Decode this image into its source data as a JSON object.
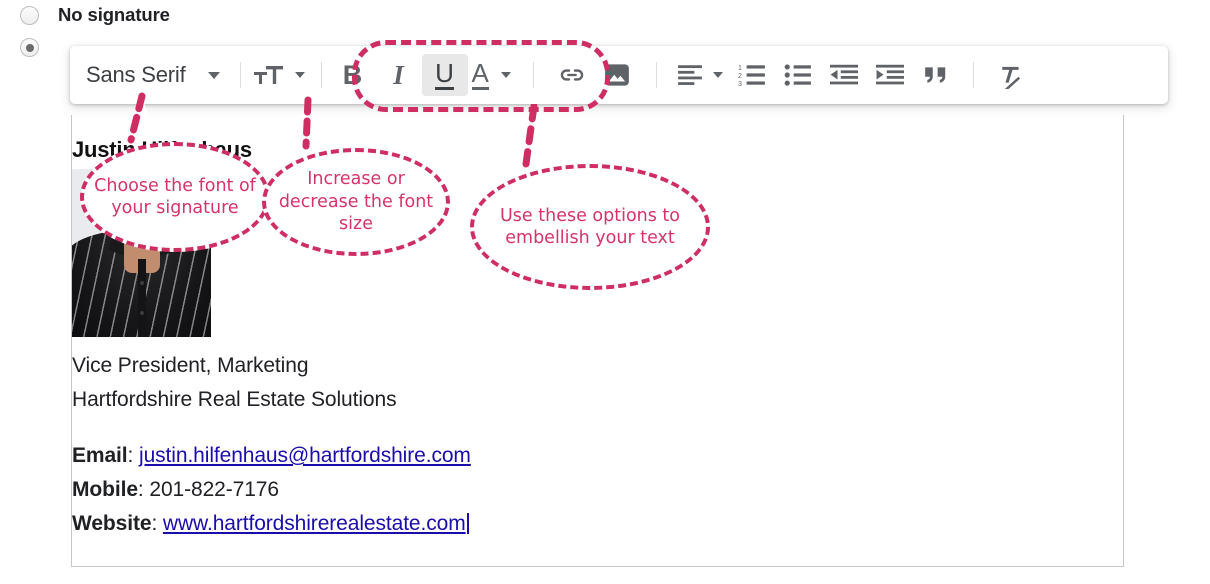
{
  "options": {
    "no_signature": {
      "label": "No signature",
      "selected": false,
      "icon": "radio-unselected-icon"
    },
    "use_signature": {
      "label": "",
      "selected": true,
      "icon": "radio-selected-icon"
    }
  },
  "toolbar": {
    "font_family": {
      "value": "Sans Serif",
      "icon": "chevron-down-icon"
    },
    "font_size": {
      "label": "Font size",
      "icon": "font-size-icon"
    },
    "bold": {
      "label": "B",
      "icon": "bold-icon",
      "active": false
    },
    "italic": {
      "label": "I",
      "icon": "italic-icon",
      "active": false
    },
    "underline": {
      "label": "U",
      "icon": "underline-icon",
      "active": true
    },
    "text_color": {
      "label": "A",
      "icon": "text-color-icon"
    },
    "insert_link": {
      "label": "Insert link",
      "icon": "link-icon"
    },
    "insert_image": {
      "label": "Insert image",
      "icon": "image-icon"
    },
    "align": {
      "label": "Align",
      "icon": "align-left-icon"
    },
    "numbered_list": {
      "label": "Numbered list",
      "icon": "numbered-list-icon"
    },
    "bulleted_list": {
      "label": "Bulleted list",
      "icon": "bulleted-list-icon"
    },
    "indent_less": {
      "label": "Decrease indent",
      "icon": "indent-decrease-icon"
    },
    "indent_more": {
      "label": "Increase indent",
      "icon": "indent-increase-icon"
    },
    "quote": {
      "label": "Quote",
      "icon": "quote-icon"
    },
    "remove_formatting": {
      "label": "Remove formatting",
      "icon": "remove-formatting-icon"
    }
  },
  "annotations": {
    "accent_color": "#d6336c",
    "font_bubble": "Choose  the font of your signature",
    "size_bubble": "Increase or decrease the font size",
    "format_bubble": "Use these options to embellish your text"
  },
  "signature": {
    "name": "Justin Hilfenhaus",
    "photo_alt": "portrait-photo",
    "title": "Vice President, Marketing",
    "company": "Hartfordshire Real Estate Solutions",
    "contacts": [
      {
        "label": "Email",
        "separator": ": ",
        "value": "justin.hilfenhaus@hartfordshire.com",
        "is_link": true
      },
      {
        "label": "Mobile",
        "separator": ": ",
        "value": "201-822-7176",
        "is_link": false
      },
      {
        "label": "Website",
        "separator": ": ",
        "value": "www.hartfordshirerealestate.com",
        "is_link": true
      }
    ]
  }
}
